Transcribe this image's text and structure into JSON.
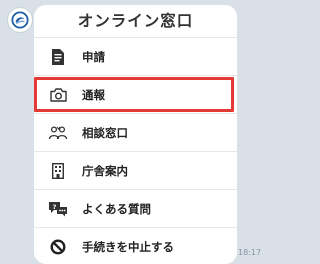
{
  "timestamp": "18:17",
  "card": {
    "title": "オンライン窓口",
    "items": [
      {
        "label": "申請",
        "icon": "document-icon",
        "name": "menu-item-application",
        "highlighted": false
      },
      {
        "label": "通報",
        "icon": "camera-icon",
        "name": "menu-item-report",
        "highlighted": true
      },
      {
        "label": "相談窓口",
        "icon": "people-icon",
        "name": "menu-item-consultation",
        "highlighted": false
      },
      {
        "label": "庁舎案内",
        "icon": "building-icon",
        "name": "menu-item-office-guide",
        "highlighted": false
      },
      {
        "label": "よくある質問",
        "icon": "chat-bubble-icon",
        "name": "menu-item-faq",
        "highlighted": false
      },
      {
        "label": "手続きを中止する",
        "icon": "prohibited-icon",
        "name": "menu-item-cancel",
        "highlighted": false
      }
    ]
  },
  "colors": {
    "background": "#d9e0e8",
    "highlight": "#e53935",
    "brand": "#1e5fa8"
  }
}
